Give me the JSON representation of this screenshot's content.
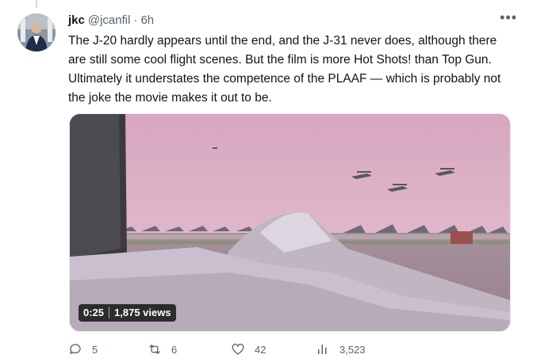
{
  "tweet": {
    "author_name": "jkc",
    "author_handle": "@jcanfil",
    "separator": "·",
    "time": "6h",
    "text": "The J-20 hardly appears until the end, and the J-31 never does, although there are still some cool flight scenes. But the film is more Hot Shots! than Top Gun. Ultimately it understates the competence of the PLAAF — which is probably not the joke the movie makes it out to be."
  },
  "video": {
    "duration": "0:25",
    "views": "1,875 views"
  },
  "actions": {
    "replies": "5",
    "retweets": "6",
    "likes": "42",
    "views": "3,523"
  },
  "icons": {
    "more": "more-dots-icon",
    "reply": "reply-icon",
    "retweet": "retweet-icon",
    "like": "heart-icon",
    "views": "views-bar-chart-icon"
  },
  "colors": {
    "text": "#0f1419",
    "muted": "#536471",
    "border": "#cfd9de"
  }
}
